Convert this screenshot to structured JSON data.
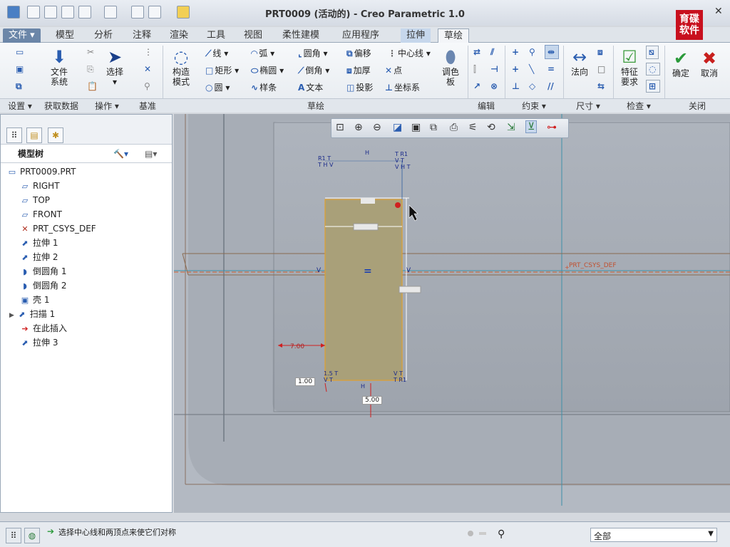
{
  "window": {
    "title": "PRT0009 (活动的) - Creo Parametric 1.0",
    "minimize": "—",
    "close": "✕",
    "help": "?"
  },
  "logo": {
    "line1": "育碟",
    "line2": "软件"
  },
  "tabs": {
    "file": "文件",
    "model": "模型",
    "analysis": "分析",
    "annotate": "注释",
    "render": "渲染",
    "tools": "工具",
    "view": "视图",
    "flexible": "柔性建模",
    "apps": "应用程序",
    "extrude": "拉伸",
    "sketch": "草绘"
  },
  "ribbon": {
    "file_system": [
      "文件",
      "系统"
    ],
    "select": "选择",
    "construct_mode": [
      "构造",
      "模式"
    ],
    "line": "线",
    "arc": "弧",
    "fillet": "圆角",
    "offset": "偏移",
    "centerline": "中心线",
    "rectangle": "矩形",
    "ellipse": "椭圆",
    "chamfer": "倒角",
    "thicken": "加厚",
    "point": "点",
    "circle": "圆",
    "spline": "样条",
    "text": "文本",
    "project": "投影",
    "csys": "坐标系",
    "palette": [
      "调色",
      "板"
    ],
    "normal": "法向",
    "feature_req": [
      "特征",
      "要求"
    ],
    "ok": "确定",
    "cancel": "取消"
  },
  "groups": {
    "setup": "设置",
    "get_data": "获取数据",
    "operations": "操作",
    "datum": "基准",
    "sketching": "草绘",
    "editing": "编辑",
    "constrain": "约束",
    "dimension": "尺寸",
    "inspect": "检查",
    "close": "关闭"
  },
  "model_tree": {
    "title": "模型树",
    "items": [
      {
        "label": "PRT0009.PRT",
        "icon": "part-icon"
      },
      {
        "label": "RIGHT",
        "icon": "datum-plane-icon"
      },
      {
        "label": "TOP",
        "icon": "datum-plane-icon"
      },
      {
        "label": "FRONT",
        "icon": "datum-plane-icon"
      },
      {
        "label": "PRT_CSYS_DEF",
        "icon": "csys-icon"
      },
      {
        "label": "拉伸 1",
        "icon": "extrude-icon"
      },
      {
        "label": "拉伸 2",
        "icon": "extrude-icon"
      },
      {
        "label": "倒圆角 1",
        "icon": "round-icon"
      },
      {
        "label": "倒圆角 2",
        "icon": "round-icon"
      },
      {
        "label": "壳 1",
        "icon": "shell-icon"
      },
      {
        "label": "扫描 1",
        "icon": "sweep-icon"
      },
      {
        "label": "在此插入",
        "icon": "insert-arrow-icon"
      },
      {
        "label": "拉伸 3",
        "icon": "extrude-icon"
      }
    ]
  },
  "sketch": {
    "dim_left": "7.00",
    "dim_bottom_left": "1.00",
    "dim_bottom": "5.00",
    "csys_label": "PRT_CSYS_DEF"
  },
  "status": {
    "message": "选择中心线和两顶点来使它们对称",
    "filter": "全部"
  },
  "colors": {
    "sketch_fill": "#a9a079",
    "sketch_outline": "#e0a030",
    "viewport_bg": "#b9bfc8",
    "accent": "#2a5db0"
  }
}
